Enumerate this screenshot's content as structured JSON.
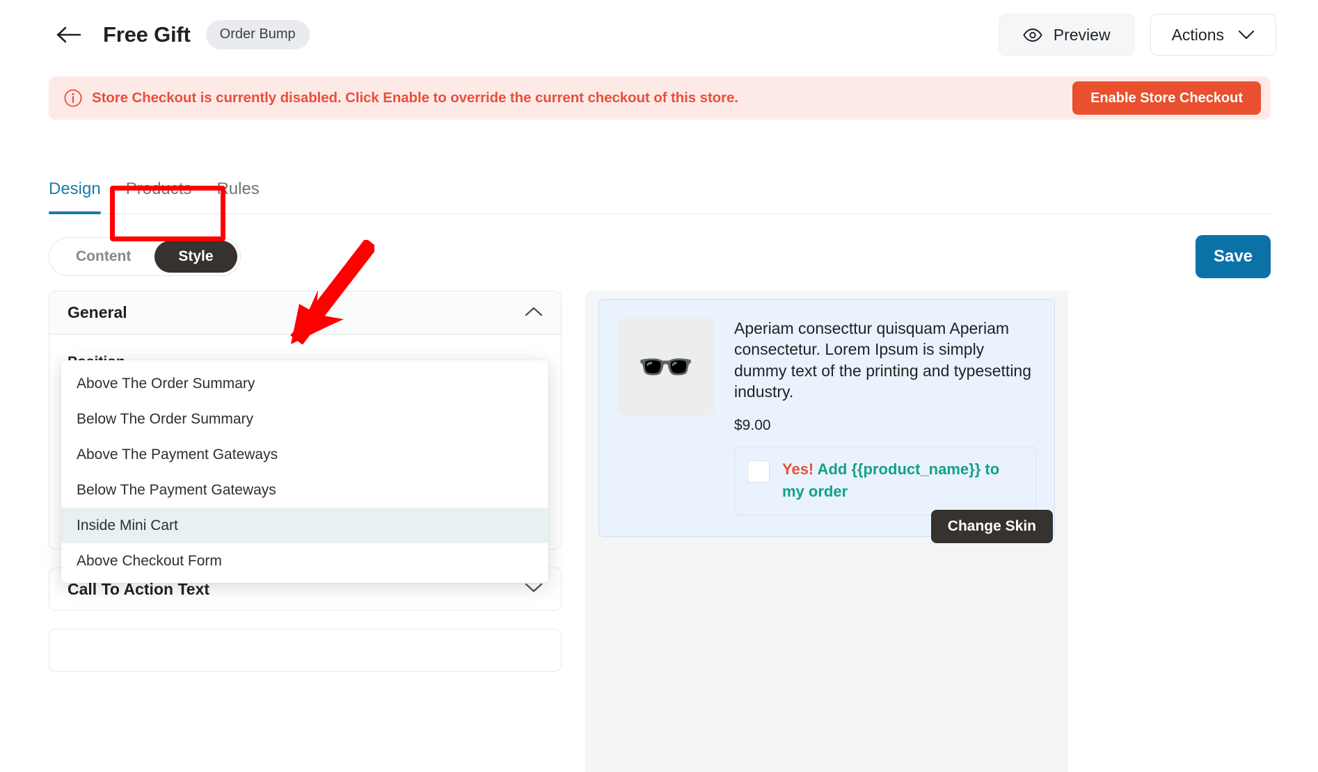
{
  "header": {
    "back_icon": "arrow-left-icon",
    "title": "Free Gift",
    "badge": "Order Bump",
    "preview_label": "Preview",
    "preview_icon": "eye-icon",
    "actions_label": "Actions",
    "actions_icon": "chevron-down-icon"
  },
  "alert": {
    "icon": "info-circle-icon",
    "message": "Store Checkout is currently disabled. Click Enable to override the current checkout of this store.",
    "button_label": "Enable Store Checkout",
    "text_color": "#e8503a",
    "background_color": "#fdeae7",
    "button_color": "#e8502f"
  },
  "tabs": {
    "items": [
      {
        "label": "Design",
        "active": true
      },
      {
        "label": "Products",
        "active": false
      },
      {
        "label": "Rules",
        "active": false
      }
    ],
    "active_color": "#1a7aad"
  },
  "toolbar": {
    "segmented": [
      {
        "label": "Content",
        "active": false
      },
      {
        "label": "Style",
        "active": true
      }
    ],
    "save_label": "Save",
    "save_color": "#0b72a8"
  },
  "left_panel": {
    "sections": [
      {
        "title": "General",
        "expanded": true
      },
      {
        "title": "Call To Action Text",
        "expanded": false
      }
    ],
    "position_field": {
      "label": "Position",
      "value": "Below The Payment Gateways",
      "open": true,
      "options": [
        {
          "label": "Above The Order Summary",
          "highlighted": false
        },
        {
          "label": "Below The Order Summary",
          "highlighted": false
        },
        {
          "label": "Above The Payment Gateways",
          "highlighted": false
        },
        {
          "label": "Below The Payment Gateways",
          "highlighted": false
        },
        {
          "label": "Inside Mini Cart",
          "highlighted": true
        },
        {
          "label": "Above Checkout Form",
          "highlighted": false
        }
      ],
      "highlight_color": "#e9f0f3"
    }
  },
  "preview": {
    "product_image_icon": "sunglasses-icon",
    "description": "Aperiam consecttur quisquam Aperiam consectetur. Lorem Ipsum is simply dummy text of the printing and typesetting industry.",
    "price": "$9.00",
    "cta_yes": "Yes!",
    "cta_rest": " Add {{product_name}} to my order",
    "cta_yes_color": "#e8503a",
    "cta_rest_color": "#11a287",
    "change_skin_label": "Change Skin",
    "card_background": "#eaf2fd"
  },
  "annotations": {
    "box_color": "#ff0000",
    "arrow_color": "#ff0000",
    "box_target": "style-toggle",
    "arrow_target": "position-select"
  }
}
